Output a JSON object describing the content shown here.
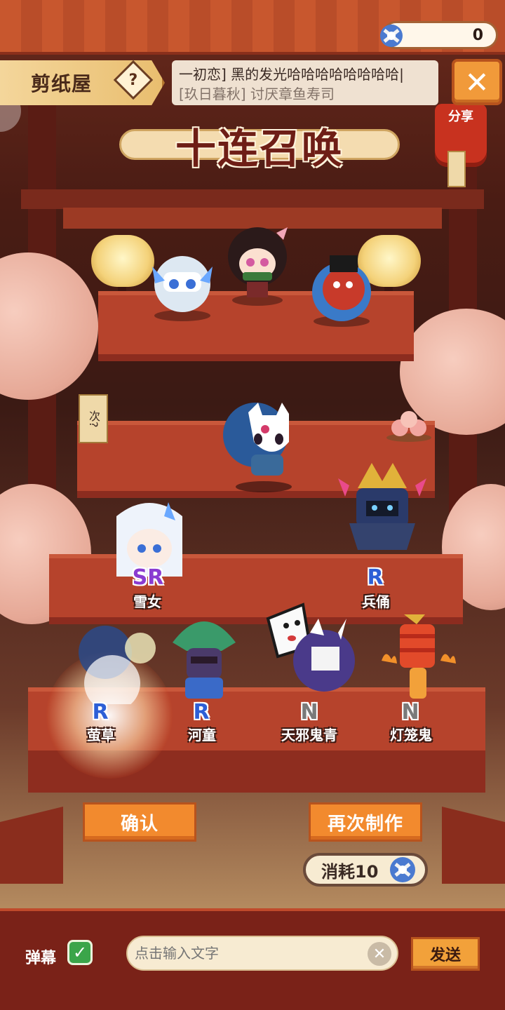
{
  "header": {
    "token_count": "0",
    "title": "剪纸屋",
    "help_label": "?",
    "close_label": "✕",
    "share_label": "分享"
  },
  "ticker": {
    "line1": "一初恋] 黑的发光哈哈哈哈哈哈哈哈|",
    "line2": "[玖日暮秋] 讨厌章鱼寿司"
  },
  "banner": {
    "title": "十连召唤"
  },
  "summons": [
    {
      "rarity": "SR",
      "name": "雪女"
    },
    {
      "rarity": "R",
      "name": "兵俑"
    },
    {
      "rarity": "R",
      "name": "萤草"
    },
    {
      "rarity": "R",
      "name": "河童"
    },
    {
      "rarity": "N",
      "name": "天邪鬼青"
    },
    {
      "rarity": "N",
      "name": "灯笼鬼"
    }
  ],
  "side_sign": "次?",
  "actions": {
    "confirm_label": "确认",
    "again_label": "再次制作",
    "cost_label": "消耗10"
  },
  "chat": {
    "danmu_label": "弹幕",
    "danmu_checked": "✓",
    "input_placeholder": "点击输入文字",
    "clear_label": "✕",
    "send_label": "发送"
  },
  "colors": {
    "accent": "#f28a2e",
    "stage": "#b6432c",
    "sr": "#8a3bd1",
    "r": "#2d5fd6",
    "n": "#7a7a7a"
  }
}
